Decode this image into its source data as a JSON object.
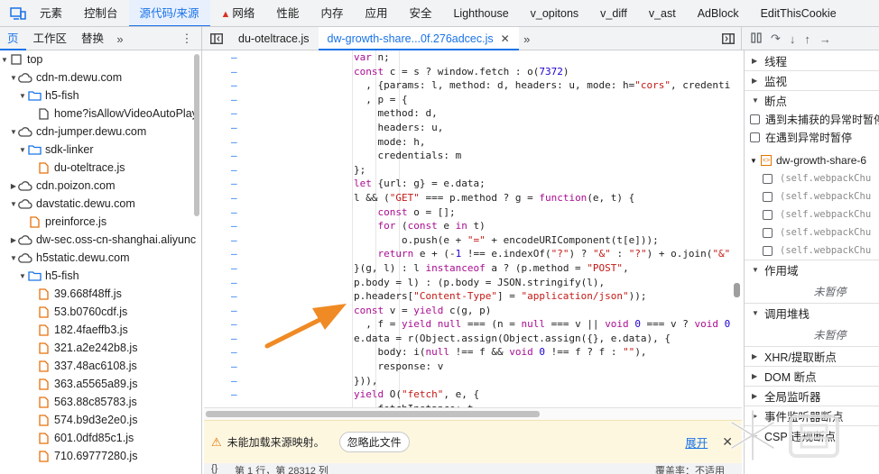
{
  "topbar": {
    "tabs": [
      {
        "label": "元素",
        "active": false
      },
      {
        "label": "控制台",
        "active": false
      },
      {
        "label": "源代码/来源",
        "active": true
      },
      {
        "label": "网络",
        "active": false,
        "warning": true
      },
      {
        "label": "性能",
        "active": false
      },
      {
        "label": "内存",
        "active": false
      },
      {
        "label": "应用",
        "active": false
      },
      {
        "label": "安全",
        "active": false
      },
      {
        "label": "Lighthouse",
        "active": false
      },
      {
        "label": "v_opitons",
        "active": false
      },
      {
        "label": "v_diff",
        "active": false
      },
      {
        "label": "v_ast",
        "active": false
      },
      {
        "label": "AdBlock",
        "active": false
      },
      {
        "label": "EditThisCookie",
        "active": false
      }
    ]
  },
  "navigator": {
    "tabs": [
      "页",
      "工作区",
      "替换"
    ],
    "more_label": "»",
    "tree": [
      {
        "label": "top",
        "icon": "frame-icon",
        "level": 0,
        "arrow": "down"
      },
      {
        "label": "cdn-m.dewu.com",
        "icon": "cloud-icon",
        "level": 1,
        "arrow": "down"
      },
      {
        "label": "h5-fish",
        "icon": "folder-icon",
        "level": 2,
        "arrow": "down"
      },
      {
        "label": "home?isAllowVideoAutoPlay",
        "icon": "document-icon",
        "level": 3,
        "arrow": ""
      },
      {
        "label": "cdn-jumper.dewu.com",
        "icon": "cloud-icon",
        "level": 1,
        "arrow": "down"
      },
      {
        "label": "sdk-linker",
        "icon": "folder-icon",
        "level": 2,
        "arrow": "down"
      },
      {
        "label": "du-oteltrace.js",
        "icon": "js-file-icon",
        "level": 3,
        "arrow": ""
      },
      {
        "label": "cdn.poizon.com",
        "icon": "cloud-icon",
        "level": 1,
        "arrow": "right"
      },
      {
        "label": "davstatic.dewu.com",
        "icon": "cloud-icon",
        "level": 1,
        "arrow": "down"
      },
      {
        "label": "preinforce.js",
        "icon": "js-file-icon",
        "level": 2,
        "arrow": ""
      },
      {
        "label": "dw-sec.oss-cn-shanghai.aliyunc",
        "icon": "cloud-icon",
        "level": 1,
        "arrow": "right"
      },
      {
        "label": "h5static.dewu.com",
        "icon": "cloud-icon",
        "level": 1,
        "arrow": "down"
      },
      {
        "label": "h5-fish",
        "icon": "folder-icon",
        "level": 2,
        "arrow": "down"
      },
      {
        "label": "39.668f48ff.js",
        "icon": "js-file-icon",
        "level": 3,
        "arrow": ""
      },
      {
        "label": "53.b0760cdf.js",
        "icon": "js-file-icon",
        "level": 3,
        "arrow": ""
      },
      {
        "label": "182.4faeffb3.js",
        "icon": "js-file-icon",
        "level": 3,
        "arrow": ""
      },
      {
        "label": "321.a2e242b8.js",
        "icon": "js-file-icon",
        "level": 3,
        "arrow": ""
      },
      {
        "label": "337.48ac6108.js",
        "icon": "js-file-icon",
        "level": 3,
        "arrow": ""
      },
      {
        "label": "363.a5565a89.js",
        "icon": "js-file-icon",
        "level": 3,
        "arrow": ""
      },
      {
        "label": "563.88c85783.js",
        "icon": "js-file-icon",
        "level": 3,
        "arrow": ""
      },
      {
        "label": "574.b9d3e2e0.js",
        "icon": "js-file-icon",
        "level": 3,
        "arrow": ""
      },
      {
        "label": "601.0dfd85c1.js",
        "icon": "js-file-icon",
        "level": 3,
        "arrow": ""
      },
      {
        "label": "710.69777280.js",
        "icon": "js-file-icon",
        "level": 3,
        "arrow": ""
      }
    ]
  },
  "editor": {
    "tabs": [
      {
        "label": "du-oteltrace.js",
        "active": false
      },
      {
        "label": "dw-growth-share...0f.276adcec.js",
        "active": true
      }
    ],
    "more_label": "»",
    "lines": [
      [
        [
          "kw",
          "var "
        ],
        [
          "fn",
          "n;"
        ]
      ],
      [
        [
          "kw",
          "const "
        ],
        [
          "fn",
          "c = s ? window.fetch : o("
        ],
        [
          "num",
          "7372"
        ],
        [
          "fn",
          ")"
        ]
      ],
      [
        [
          "fn",
          "  , {params: l, method: d, headers: u, mode: h="
        ],
        [
          "str",
          "\"cors\""
        ],
        [
          "fn",
          ", credenti"
        ]
      ],
      [
        [
          "fn",
          "  , p = {"
        ]
      ],
      [
        [
          "fn",
          "    method: d,"
        ]
      ],
      [
        [
          "fn",
          "    headers: u,"
        ]
      ],
      [
        [
          "fn",
          "    mode: h,"
        ]
      ],
      [
        [
          "fn",
          "    credentials: m"
        ]
      ],
      [
        [
          "fn",
          "};"
        ]
      ],
      [
        [
          "kw",
          "let "
        ],
        [
          "fn",
          "{url: g} = e.data;"
        ]
      ],
      [
        [
          "fn",
          "l && ("
        ],
        [
          "str",
          "\"GET\""
        ],
        [
          "fn",
          " === p.method ? g = "
        ],
        [
          "kw",
          "function"
        ],
        [
          "fn",
          "(e, t) {"
        ]
      ],
      [
        [
          "fn",
          "    "
        ],
        [
          "kw",
          "const "
        ],
        [
          "fn",
          "o = [];"
        ]
      ],
      [
        [
          "fn",
          "    "
        ],
        [
          "kw",
          "for "
        ],
        [
          "fn",
          "("
        ],
        [
          "kw",
          "const "
        ],
        [
          "fn",
          "e "
        ],
        [
          "kw",
          "in "
        ],
        [
          "fn",
          "t)"
        ]
      ],
      [
        [
          "fn",
          "        o.push(e + "
        ],
        [
          "str",
          "\"=\""
        ],
        [
          "fn",
          " + encodeURIComponent(t[e]));"
        ]
      ],
      [
        [
          "fn",
          "    "
        ],
        [
          "kw",
          "return "
        ],
        [
          "fn",
          "e + (-"
        ],
        [
          "num",
          "1"
        ],
        [
          "fn",
          " !== e.indexOf("
        ],
        [
          "str",
          "\"?\""
        ],
        [
          "fn",
          ") ? "
        ],
        [
          "str",
          "\"&\""
        ],
        [
          "fn",
          " : "
        ],
        [
          "str",
          "\"?\""
        ],
        [
          "fn",
          ") + o.join("
        ],
        [
          "str",
          "\"&\""
        ]
      ],
      [
        [
          "fn",
          "}(g, l) : l "
        ],
        [
          "kw",
          "instanceof "
        ],
        [
          "fn",
          "a ? (p.method = "
        ],
        [
          "str",
          "\"POST\""
        ],
        [
          "fn",
          ","
        ]
      ],
      [
        [
          "fn",
          "p.body = l) : (p.body = JSON.stringify(l),"
        ]
      ],
      [
        [
          "fn",
          "p.headers["
        ],
        [
          "str",
          "\"Content-Type\""
        ],
        [
          "fn",
          "] = "
        ],
        [
          "str",
          "\"application/json\""
        ],
        [
          "fn",
          "));"
        ]
      ],
      [
        [
          "kw",
          "const "
        ],
        [
          "fn",
          "v = "
        ],
        [
          "kw",
          "yield "
        ],
        [
          "fn",
          "c(g, p)"
        ]
      ],
      [
        [
          "fn",
          "  , f = "
        ],
        [
          "kw",
          "yield null "
        ],
        [
          "fn",
          "=== (n = "
        ],
        [
          "kw",
          "null "
        ],
        [
          "fn",
          "=== v || "
        ],
        [
          "kw",
          "void "
        ],
        [
          "num",
          "0"
        ],
        [
          "fn",
          " === v ? "
        ],
        [
          "kw",
          "void "
        ],
        [
          "num",
          "0"
        ]
      ],
      [
        [
          "fn",
          "e.data = r(Object.assign(Object.assign({}, e.data), {"
        ]
      ],
      [
        [
          "fn",
          "    body: i("
        ],
        [
          "kw",
          "null "
        ],
        [
          "fn",
          "!== f && "
        ],
        [
          "kw",
          "void "
        ],
        [
          "num",
          "0"
        ],
        [
          "fn",
          " !== f ? f : "
        ],
        [
          "str",
          "\"\""
        ],
        [
          "fn",
          "),"
        ]
      ],
      [
        [
          "fn",
          "    response: v"
        ]
      ],
      [
        [
          "fn",
          "})),"
        ]
      ],
      [
        [
          "kw",
          "yield "
        ],
        [
          "fn",
          "O("
        ],
        [
          "str",
          "\"fetch\""
        ],
        [
          "fn",
          ", e, {"
        ]
      ],
      [
        [
          "fn",
          "    fetchInstance: t"
        ]
      ]
    ]
  },
  "warning": {
    "message": "未能加载来源映射。",
    "ignore_label": "忽略此文件",
    "expand_label": "展开"
  },
  "status": {
    "position": "第 1 行，第 28312 列",
    "coverage": "覆盖率：不适用"
  },
  "debugger": {
    "sections": {
      "threads": "线程",
      "watch": "监视",
      "breakpoints": "断点",
      "scope": "作用域",
      "callstack": "调用堆栈",
      "xhr": "XHR/提取断点",
      "dom": "DOM 断点",
      "global": "全局监听器",
      "event": "事件监听器断点",
      "csp": "CSP 违规断点"
    },
    "pause_uncaught": "遇到未捕获的异常时暂停",
    "pause_caught": "在遇到异常时暂停",
    "bp_file": "dw-growth-share-6",
    "bp_lines": [
      "(self.webpackChu",
      "(self.webpackChu",
      "(self.webpackChu",
      "(self.webpackChu",
      "(self.webpackChu"
    ],
    "not_paused": "未暂停"
  },
  "colors": {
    "accent": "#1a73e8",
    "annotation_arrow": "#f08a24",
    "warning": "#e37400"
  }
}
